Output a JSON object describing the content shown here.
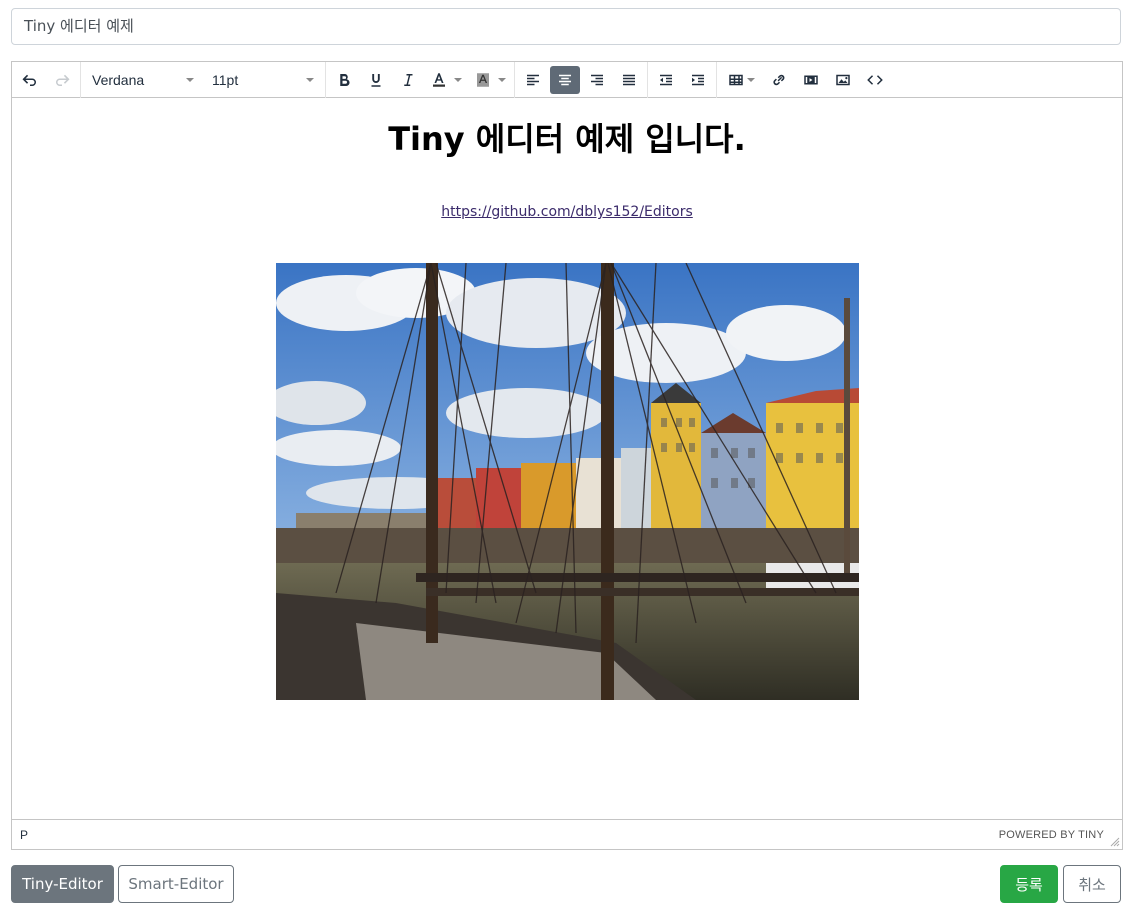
{
  "title_input": {
    "value": "Tiny 에디터 예제"
  },
  "toolbar": {
    "font_family": "Verdana",
    "font_size": "11pt",
    "icons": [
      "undo-icon",
      "redo-icon",
      "bold-icon",
      "underline-icon",
      "italic-icon",
      "text-color-icon",
      "background-color-icon",
      "align-left-icon",
      "align-center-icon",
      "align-right-icon",
      "align-justify-icon",
      "outdent-icon",
      "indent-icon",
      "table-icon",
      "link-icon",
      "media-icon",
      "image-icon",
      "code-icon"
    ],
    "active": "align-center"
  },
  "content": {
    "heading_bold": "Tiny",
    "heading_rest": " 에디터 예제 입니다.",
    "link": "https://github.com/dblys152/Editors"
  },
  "statusbar": {
    "path": "P",
    "brand": "POWERED BY TINY"
  },
  "buttons": {
    "tiny": "Tiny-Editor",
    "smart": "Smart-Editor",
    "save": "등록",
    "cancel": "취소"
  },
  "colors": {
    "active_button": "#5f6a76",
    "save_button": "#28a745",
    "secondary": "#6c757d"
  }
}
